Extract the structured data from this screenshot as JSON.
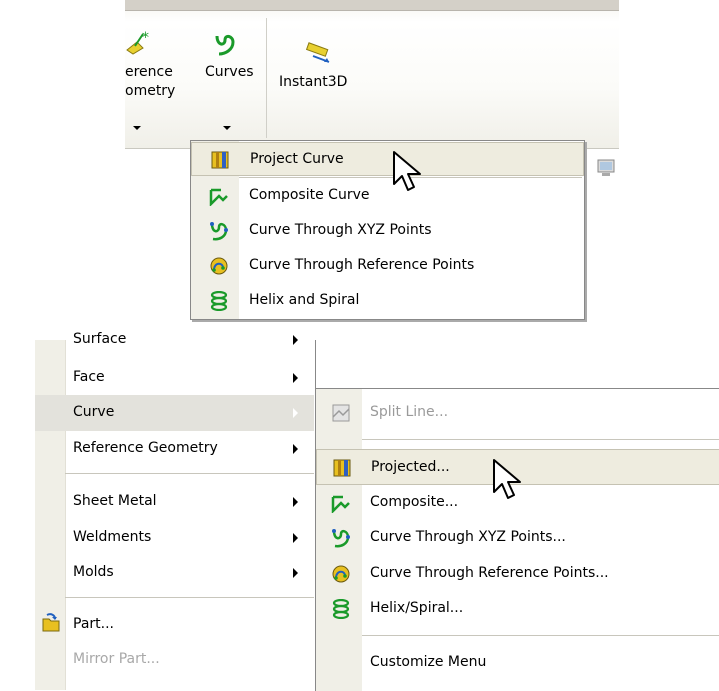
{
  "toolbar": {
    "ref_geometry_line1": "erence",
    "ref_geometry_line2": "ometry",
    "curves_label": "Curves",
    "instant3d_label": "Instant3D"
  },
  "flyout": {
    "items": [
      {
        "label": "Project Curve",
        "icon": "project-curve-icon"
      },
      {
        "label": "Composite Curve",
        "icon": "composite-curve-icon"
      },
      {
        "label": "Curve Through XYZ Points",
        "icon": "curve-xyz-icon"
      },
      {
        "label": "Curve Through Reference Points",
        "icon": "curve-reference-points-icon"
      },
      {
        "label": "Helix and Spiral",
        "icon": "helix-icon"
      }
    ]
  },
  "menu": {
    "items": [
      {
        "label": "Surface"
      },
      {
        "label": "Face"
      },
      {
        "label": "Curve"
      },
      {
        "label": "Reference Geometry"
      },
      {
        "label": "Sheet Metal"
      },
      {
        "label": "Weldments"
      },
      {
        "label": "Molds"
      },
      {
        "label": "Part..."
      },
      {
        "label": "Mirror Part..."
      }
    ]
  },
  "submenu": {
    "items": [
      {
        "label": "Split Line...",
        "icon": "split-line-icon"
      },
      {
        "label": "Projected...",
        "icon": "project-curve-icon"
      },
      {
        "label": "Composite...",
        "icon": "composite-curve-icon"
      },
      {
        "label": "Curve Through XYZ Points...",
        "icon": "curve-xyz-icon"
      },
      {
        "label": "Curve Through Reference Points...",
        "icon": "curve-reference-points-icon"
      },
      {
        "label": "Helix/Spiral...",
        "icon": "helix-icon"
      },
      {
        "label": "Customize Menu"
      }
    ]
  },
  "colors": {
    "gutter": "#f0efe7",
    "highlight": "#eeecdf",
    "icon_green": "#1a9a2a",
    "icon_yellow": "#e8c020",
    "icon_blue": "#2060c0",
    "disabled_text": "#a8a8a8"
  }
}
